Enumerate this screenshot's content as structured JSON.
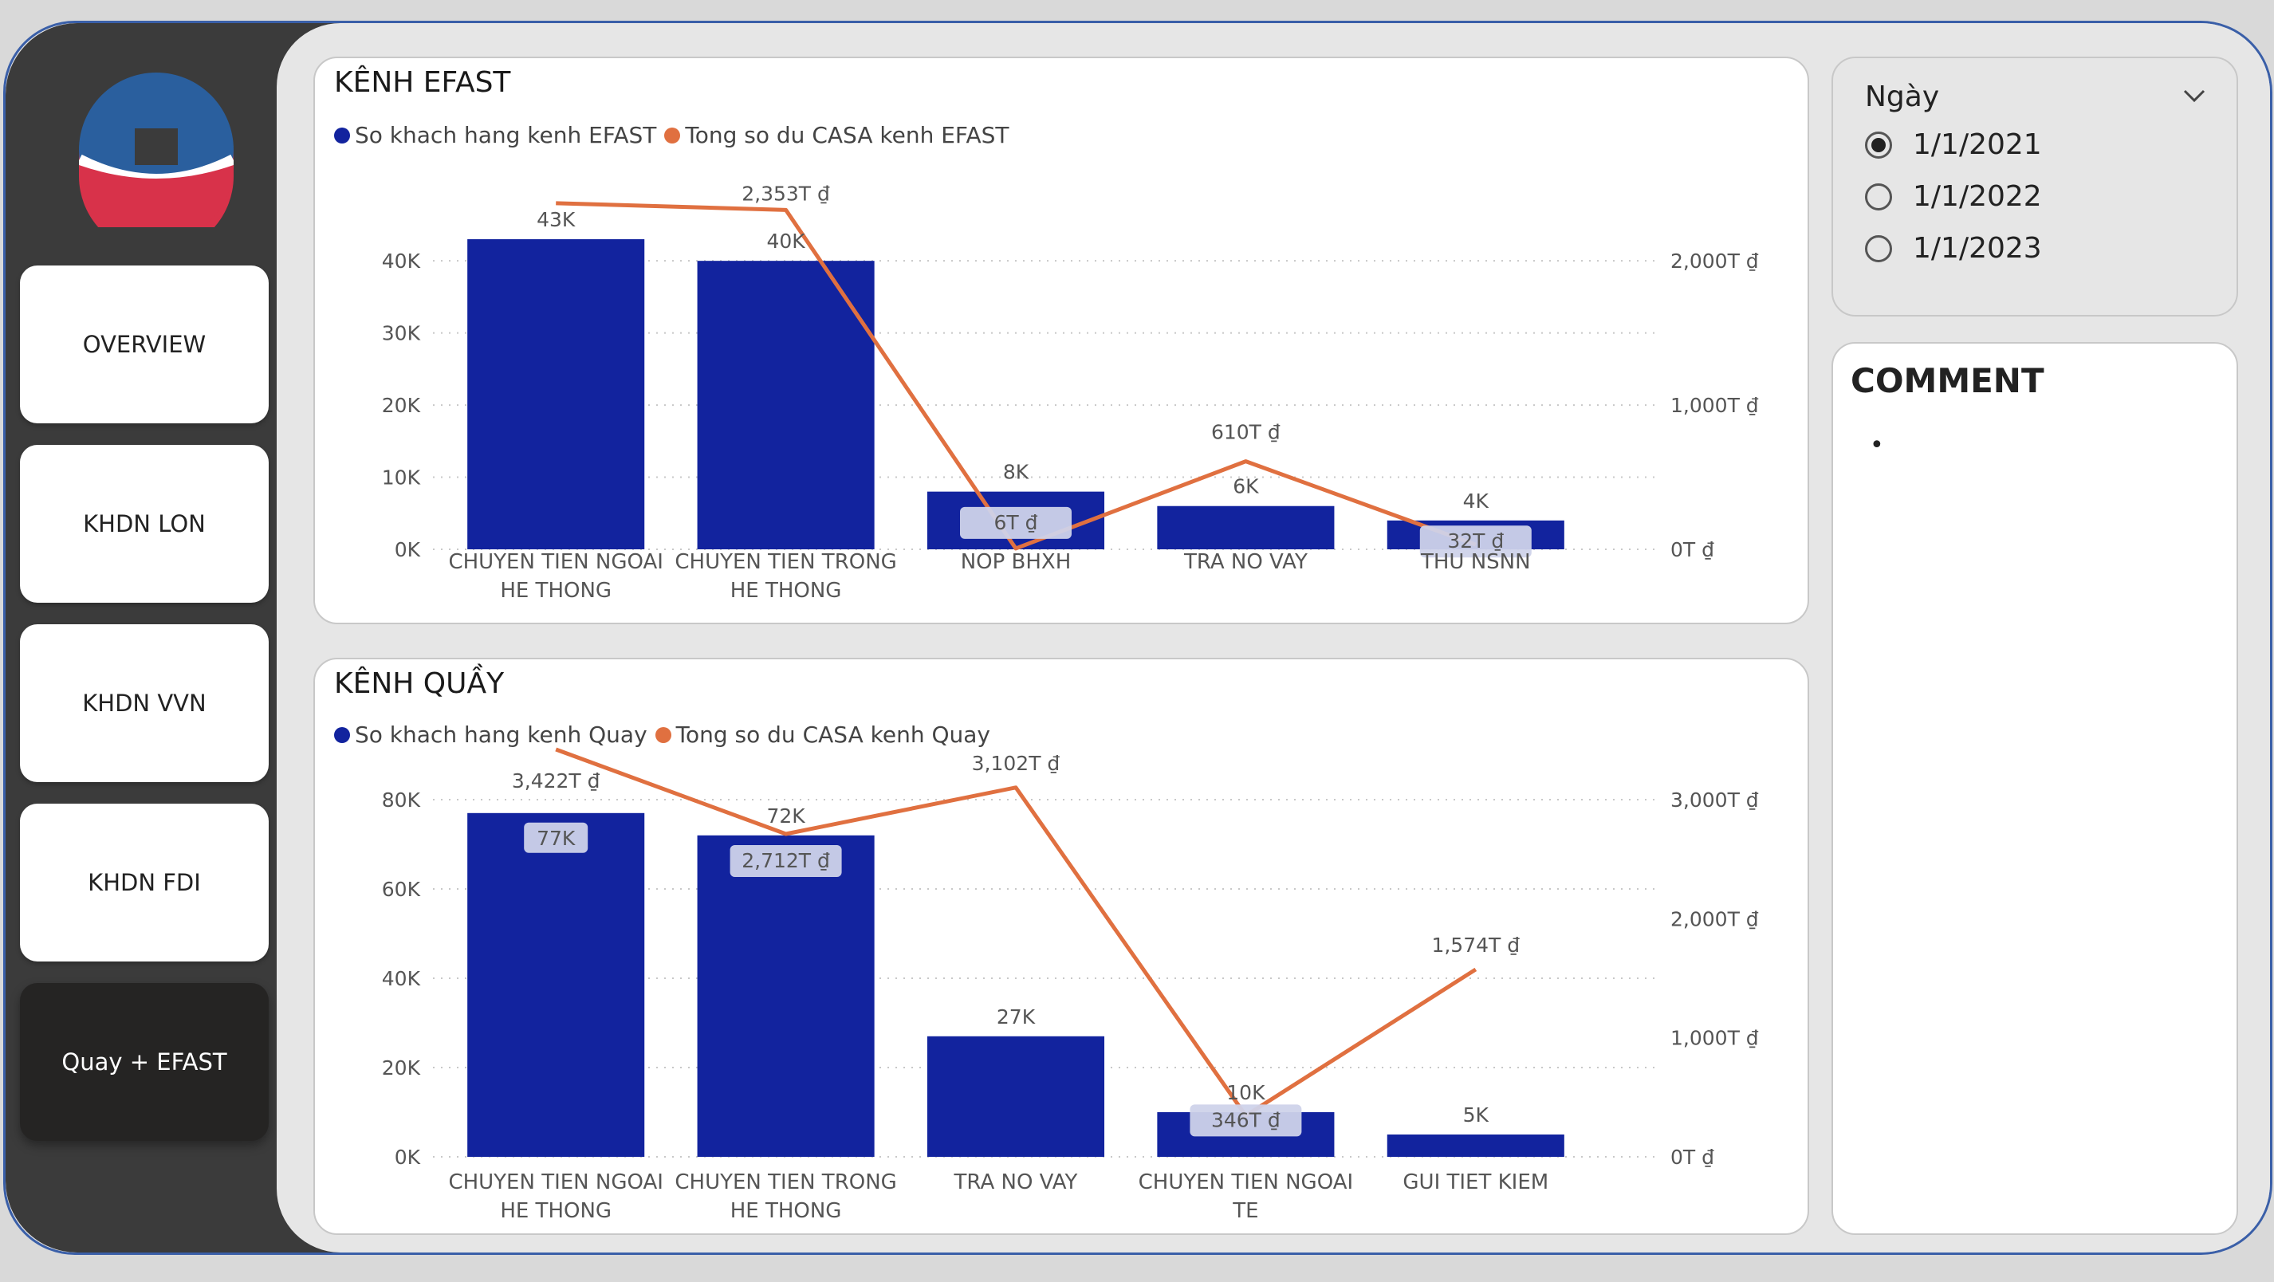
{
  "nav": {
    "items": [
      {
        "label": "OVERVIEW",
        "active": false
      },
      {
        "label": "KHDN LON",
        "active": false
      },
      {
        "label": "KHDN VVN",
        "active": false
      },
      {
        "label": "KHDN FDI",
        "active": false
      },
      {
        "label": "Quay + EFAST",
        "active": true
      }
    ]
  },
  "colors": {
    "bar": "#12239e",
    "line": "#e07040",
    "sidebar": "#3b3b3b",
    "logo_blue": "#2a5f9e",
    "logo_red": "#d8324a"
  },
  "panels": {
    "efast": {
      "title": "KÊNH EFAST",
      "legend": [
        "So khach hang kenh EFAST",
        "Tong so du CASA kenh EFAST"
      ]
    },
    "quay": {
      "title": "KÊNH QUẦY",
      "legend": [
        "So khach hang kenh Quay",
        "Tong so du CASA kenh Quay"
      ]
    }
  },
  "chart_data": [
    {
      "type": "bar",
      "title": "KÊNH EFAST",
      "categories": [
        "CHUYEN TIEN NGOAI|HE THONG",
        "CHUYEN TIEN TRONG|HE THONG",
        "NOP BHXH",
        "TRA NO VAY",
        "THU NSNN"
      ],
      "series": [
        {
          "name": "So khach hang kenh EFAST",
          "type": "bar",
          "axis": "left",
          "values": [
            43000,
            40000,
            8000,
            6000,
            4000
          ],
          "labels": [
            "43K",
            "40K",
            "8K",
            "6K",
            "4K"
          ]
        },
        {
          "name": "Tong so du CASA kenh EFAST",
          "type": "line",
          "axis": "right",
          "values": [
            2400,
            2353,
            6,
            610,
            32
          ],
          "labels": [
            "",
            "2,353T ₫",
            "6T ₫",
            "610T ₫",
            "32T ₫"
          ]
        }
      ],
      "y_left": {
        "ticks": [
          "0K",
          "10K",
          "20K",
          "30K",
          "40K"
        ],
        "tick_values": [
          0,
          10000,
          20000,
          30000,
          40000
        ],
        "ylim": [
          0,
          44000
        ]
      },
      "y_right": {
        "ticks": [
          "0T ₫",
          "1,000T ₫",
          "2,000T ₫"
        ],
        "tick_values": [
          0,
          1000,
          2000
        ],
        "ylim": [
          0,
          2200
        ]
      },
      "grid": true,
      "legend": "top-left"
    },
    {
      "type": "bar",
      "title": "KÊNH QUẦY",
      "categories": [
        "CHUYEN TIEN NGOAI|HE THONG",
        "CHUYEN TIEN TRONG|HE THONG",
        "TRA NO VAY",
        "CHUYEN TIEN NGOAI|TE",
        "GUI TIET KIEM"
      ],
      "series": [
        {
          "name": "So khach hang kenh Quay",
          "type": "bar",
          "axis": "left",
          "values": [
            77000,
            72000,
            27000,
            10000,
            5000
          ],
          "labels": [
            "77K",
            "72K",
            "27K",
            "10K",
            "5K"
          ]
        },
        {
          "name": "Tong so du CASA kenh Quay",
          "type": "line",
          "axis": "right",
          "values": [
            3422,
            2712,
            3102,
            346,
            1574
          ],
          "labels": [
            "3,422T ₫",
            "2,712T ₫",
            "3,102T ₫",
            "346T ₫",
            "1,574T ₫"
          ]
        }
      ],
      "y_left": {
        "ticks": [
          "0K",
          "20K",
          "40K",
          "60K",
          "80K"
        ],
        "tick_values": [
          0,
          20000,
          40000,
          60000,
          80000
        ],
        "ylim": [
          0,
          80000
        ]
      },
      "y_right": {
        "ticks": [
          "0T ₫",
          "1,000T ₫",
          "2,000T ₫",
          "3,000T ₫"
        ],
        "tick_values": [
          0,
          1000,
          2000,
          3000
        ],
        "ylim": [
          0,
          3000
        ]
      },
      "grid": true,
      "legend": "top-left"
    }
  ],
  "slicer": {
    "title": "Ngày",
    "options": [
      {
        "label": "1/1/2021",
        "selected": true
      },
      {
        "label": "1/1/2022",
        "selected": false
      },
      {
        "label": "1/1/2023",
        "selected": false
      }
    ]
  },
  "comment": {
    "title": "COMMENT",
    "bullet": "•"
  }
}
